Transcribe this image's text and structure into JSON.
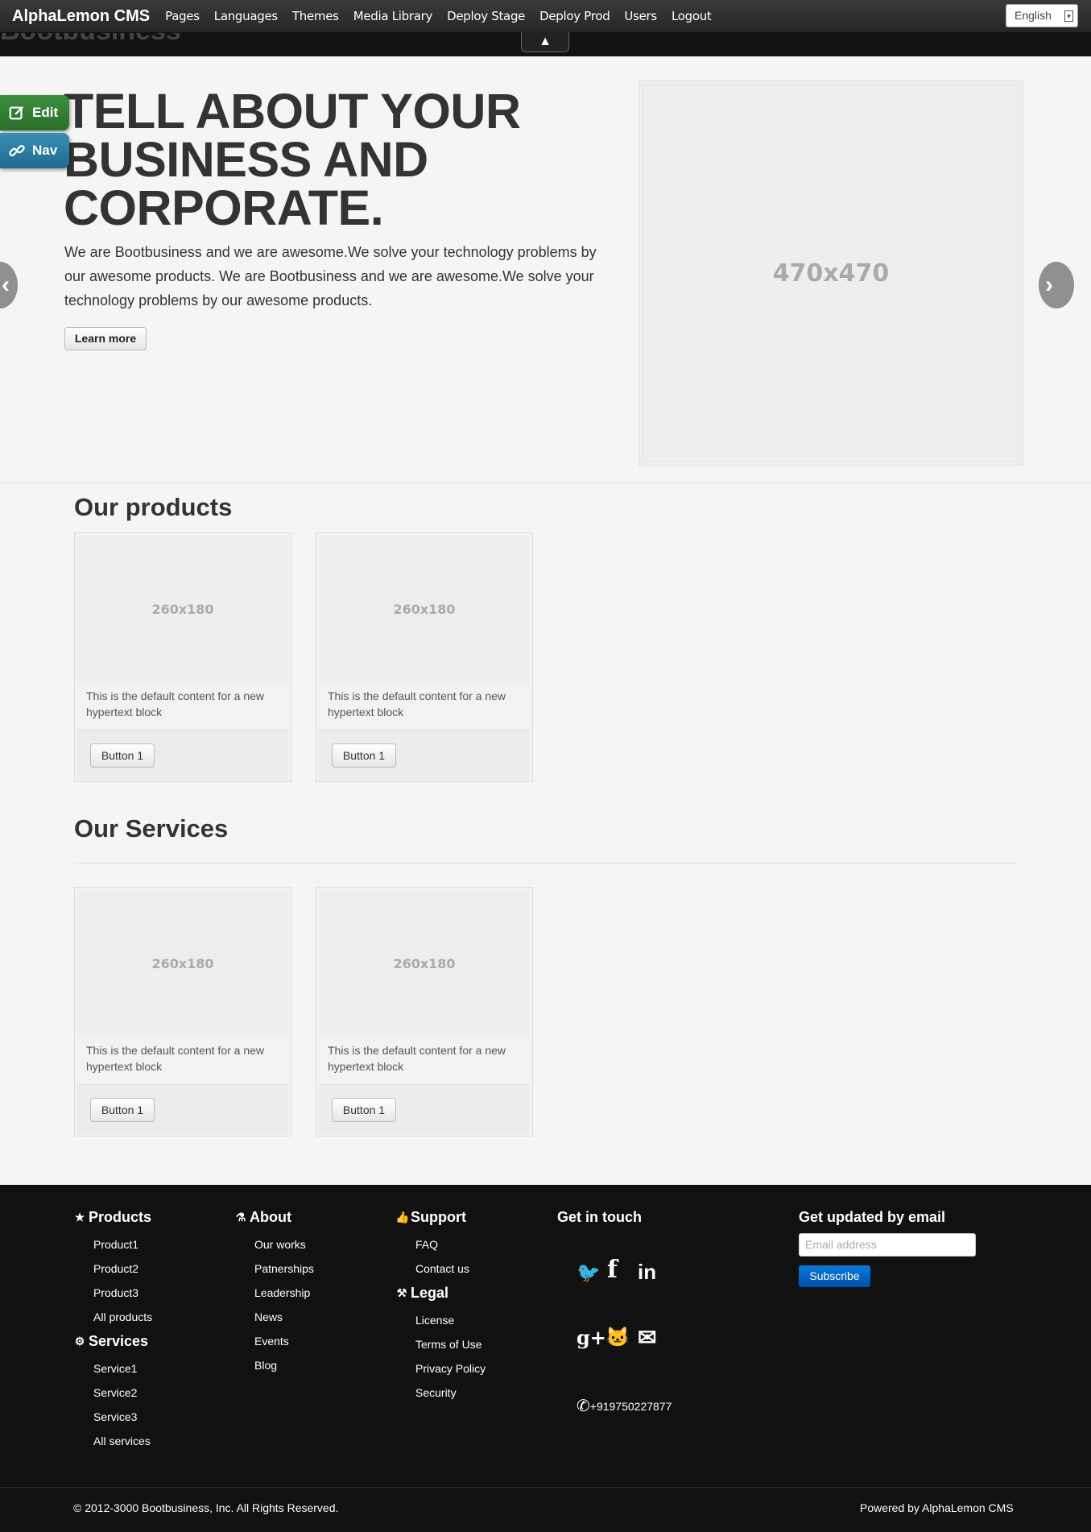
{
  "topbar": {
    "brand": "AlphaLemon CMS",
    "menu": [
      "Pages",
      "Languages",
      "Themes",
      "Media Library",
      "Deploy Stage",
      "Deploy Prod",
      "Users",
      "Logout"
    ],
    "language": "English",
    "toggle_icon": "triangle-up-icon"
  },
  "side_buttons": {
    "edit": "Edit",
    "nav": "Nav"
  },
  "ghost_brand": "Bootbusiness",
  "hero": {
    "title_lines": [
      "TELL ABOUT YOUR",
      "BUSINESS AND",
      "CORPORATE."
    ],
    "body": "We are Bootbusiness and we are awesome.We solve your technology problems by our awesome products. We are Bootbusiness and we are awesome.We solve your technology problems by our awesome products.",
    "button": "Learn more",
    "image_placeholder": "470x470"
  },
  "products": {
    "title": "Our products",
    "cards": [
      {
        "image": "260x180",
        "text": "This is the default content for a new hypertext block",
        "button": "Button 1"
      },
      {
        "image": "260x180",
        "text": "This is the default content for a new hypertext block",
        "button": "Button 1"
      }
    ]
  },
  "services": {
    "title": "Our Services",
    "cards": [
      {
        "image": "260x180",
        "text": "This is the default content for a new hypertext block",
        "button": "Button 1"
      },
      {
        "image": "260x180",
        "text": "This is the default content for a new hypertext block",
        "button": "Button 1"
      }
    ]
  },
  "footer": {
    "products": {
      "title": "Products",
      "items": [
        "Product1",
        "Product2",
        "Product3",
        "All products"
      ]
    },
    "services": {
      "title": "Services",
      "items": [
        "Service1",
        "Service2",
        "Service3",
        "All services"
      ]
    },
    "about": {
      "title": "About",
      "items": [
        "Our works",
        "Patnerships",
        "Leadership",
        "News",
        "Events",
        "Blog"
      ]
    },
    "support": {
      "title": "Support",
      "items": [
        "FAQ",
        "Contact us"
      ]
    },
    "legal": {
      "title": "Legal",
      "items": [
        "License",
        "Terms of Use",
        "Privacy Policy",
        "Security"
      ]
    },
    "contact": {
      "title": "Get in touch",
      "phone": "+919750227877"
    },
    "newsletter": {
      "title": "Get updated by email",
      "placeholder": "Email address",
      "button": "Subscribe"
    },
    "copyright": "© 2012-3000 Bootbusiness, Inc. All Rights Reserved.",
    "powered_by": "Powered by AlphaLemon CMS"
  }
}
